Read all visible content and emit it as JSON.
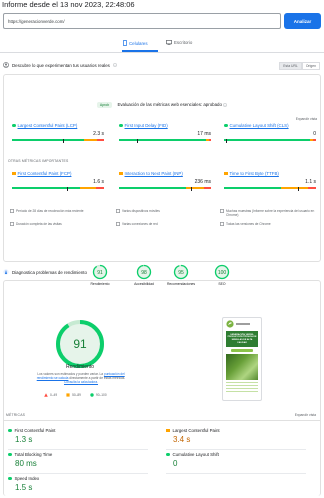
{
  "report": {
    "date_line": "Informe desde el 13 nov 2023, 22:48:06"
  },
  "search": {
    "url_value": "https://generacionverde.com/",
    "analyze_label": "Analizar"
  },
  "device_tabs": {
    "mobile": "Celulares",
    "desktop": "Escritorio"
  },
  "field_data": {
    "heading": "Descubre lo que experimentan tus usuarios reales",
    "toggle_this_url": "Esta URL",
    "toggle_origin": "Origen",
    "cwv_badge": "Aprob",
    "cwv_title": "Evaluación de las métricas web esenciales: aprobado",
    "expand_label": "Expandir vista",
    "core_metrics": [
      {
        "name": "Largest Contentful Paint (LCP)",
        "value": "2.3 s",
        "status_color": "#0cce6b",
        "bar": [
          0.78,
          0.14,
          0.08
        ],
        "marker": 0.55
      },
      {
        "name": "First Input Delay (FID)",
        "value": "17 ms",
        "status_color": "#0cce6b",
        "bar": [
          0.95,
          0.03,
          0.02
        ],
        "marker": 0.2
      },
      {
        "name": "Cumulative Layout Shift (CLS)",
        "value": "0",
        "status_color": "#0cce6b",
        "bar": [
          0.93,
          0.04,
          0.03
        ],
        "marker": 0.02
      }
    ],
    "other_header": "OTRAS MÉTRICAS IMPORTANTES",
    "other_metrics": [
      {
        "name": "First Contentful Paint (FCP)",
        "value": "1.6 s",
        "status_color": "#ffa400",
        "bar": [
          0.74,
          0.17,
          0.09
        ],
        "marker": 0.6
      },
      {
        "name": "Interaction to Next Paint (INP)",
        "value": "236 ms",
        "status_color": "#ffa400",
        "bar": [
          0.73,
          0.19,
          0.08
        ],
        "marker": 0.78
      },
      {
        "name": "Time to First Byte (TTFB)",
        "value": "1.1 s",
        "status_color": "#ffa400",
        "bar": [
          0.62,
          0.29,
          0.09
        ],
        "marker": 0.8
      }
    ],
    "info": [
      "Período de 28 días de recolección más reciente",
      "Varios dispositivos móviles",
      "Muchas muestras (Informe sobre la experiencia del usuario en Chrome)",
      "Duración completa de las visitas",
      "Varias conexiones de red",
      "Todas las versiones de Chrome"
    ]
  },
  "diagnostics": {
    "heading": "Diagnostica problemas de rendimiento",
    "categories": [
      {
        "score": "91",
        "label": "Rendimiento",
        "color": "#0cce6b"
      },
      {
        "score": "98",
        "label": "Accesibilidad",
        "color": "#0cce6b"
      },
      {
        "score": "95",
        "label": "Recomendaciones",
        "color": "#0cce6b"
      },
      {
        "score": "100",
        "label": "SEO",
        "color": "#0cce6b"
      }
    ],
    "perf_score": "91",
    "perf_label": "Rendimiento",
    "note_text": "Los valores son estimados y pueden variar. La ",
    "note_link1": "puntuación del rendimiento se calcula",
    "note_text2": " directamente a partir de estas métricas. ",
    "note_link2": "Consulta la calculadora.",
    "legend": [
      "0–49",
      "50–89",
      "90–100"
    ],
    "screenshot_title": "GENERACIÓN VERDE: PRODUCCIÓN TÉCNICA DE SEMILLAS DE ALTA CALIDAD",
    "metrics_header": "MÉTRICAS",
    "expand_label": "Expandir vista",
    "lab_metrics": [
      {
        "name": "First Contentful Paint",
        "value": "1.3 s",
        "color": "#0cce6b",
        "shape": "circle"
      },
      {
        "name": "Largest Contentful Paint",
        "value": "3.4 s",
        "color": "#ffa400",
        "shape": "square"
      },
      {
        "name": "Total Blocking Time",
        "value": "80 ms",
        "color": "#0cce6b",
        "shape": "circle"
      },
      {
        "name": "Cumulative Layout Shift",
        "value": "0",
        "color": "#0cce6b",
        "shape": "circle"
      },
      {
        "name": "Speed Index",
        "value": "1.5 s",
        "color": "#0cce6b",
        "shape": "circle"
      }
    ]
  },
  "colors": {
    "accent": "#1a73e8",
    "good": "#0cce6b",
    "average": "#ffa400",
    "poor": "#ff4e42"
  }
}
